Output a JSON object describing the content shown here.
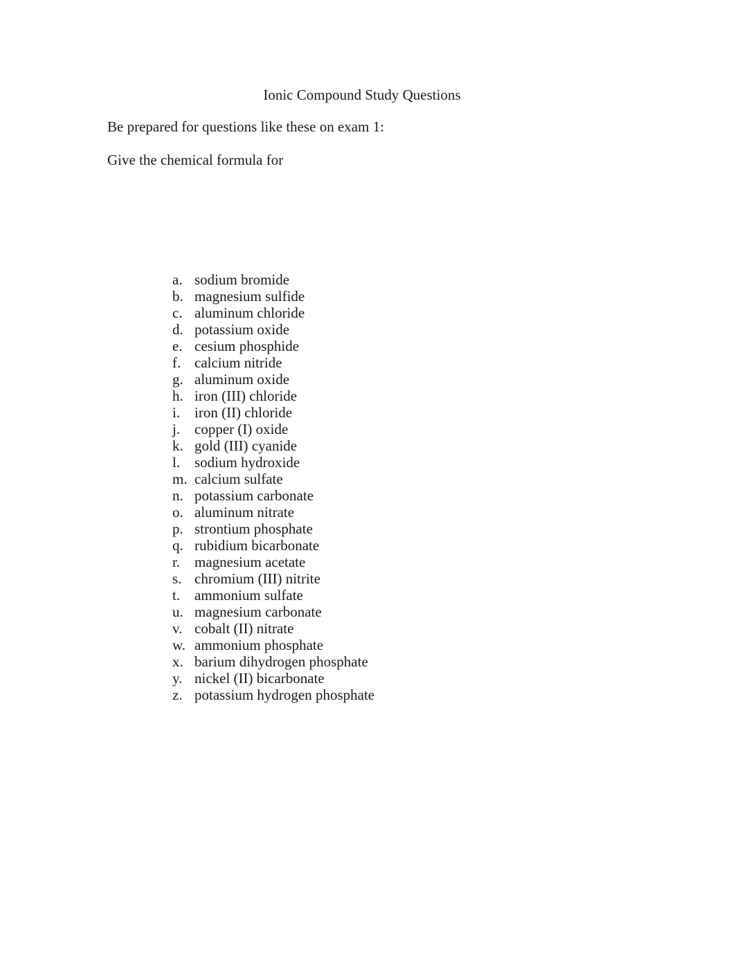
{
  "document": {
    "title": "Ionic Compound Study Questions",
    "intro_line_1": "Be prepared for questions like these on exam 1:",
    "intro_line_2": "Give the chemical formula for",
    "text_color": "#1a1a1a",
    "background_color": "#ffffff"
  },
  "list": {
    "items": [
      {
        "marker": "a.",
        "label": "sodium bromide"
      },
      {
        "marker": "b.",
        "label": "magnesium sulfide"
      },
      {
        "marker": "c.",
        "label": "aluminum chloride"
      },
      {
        "marker": "d.",
        "label": "potassium oxide"
      },
      {
        "marker": "e.",
        "label": "cesium phosphide"
      },
      {
        "marker": "f.",
        "label": "calcium nitride"
      },
      {
        "marker": "g.",
        "label": "aluminum oxide"
      },
      {
        "marker": "h.",
        "label": "iron (III) chloride"
      },
      {
        "marker": "i.",
        "label": "iron (II) chloride"
      },
      {
        "marker": "j.",
        "label": "copper (I) oxide"
      },
      {
        "marker": "k.",
        "label": "gold (III) cyanide"
      },
      {
        "marker": "l.",
        "label": "sodium hydroxide"
      },
      {
        "marker": "m.",
        "label": "calcium sulfate"
      },
      {
        "marker": "n.",
        "label": "potassium carbonate"
      },
      {
        "marker": "o.",
        "label": "aluminum nitrate"
      },
      {
        "marker": "p.",
        "label": "strontium phosphate"
      },
      {
        "marker": "q.",
        "label": "rubidium bicarbonate"
      },
      {
        "marker": "r.",
        "label": "magnesium acetate"
      },
      {
        "marker": "s.",
        "label": "chromium (III) nitrite"
      },
      {
        "marker": "t.",
        "label": "ammonium sulfate"
      },
      {
        "marker": "u.",
        "label": "magnesium carbonate"
      },
      {
        "marker": "v.",
        "label": "cobalt (II) nitrate"
      },
      {
        "marker": "w.",
        "label": "ammonium phosphate"
      },
      {
        "marker": "x.",
        "label": "barium dihydrogen phosphate"
      },
      {
        "marker": "y.",
        "label": "nickel (II) bicarbonate"
      },
      {
        "marker": "z.",
        "label": "potassium hydrogen phosphate"
      }
    ]
  }
}
